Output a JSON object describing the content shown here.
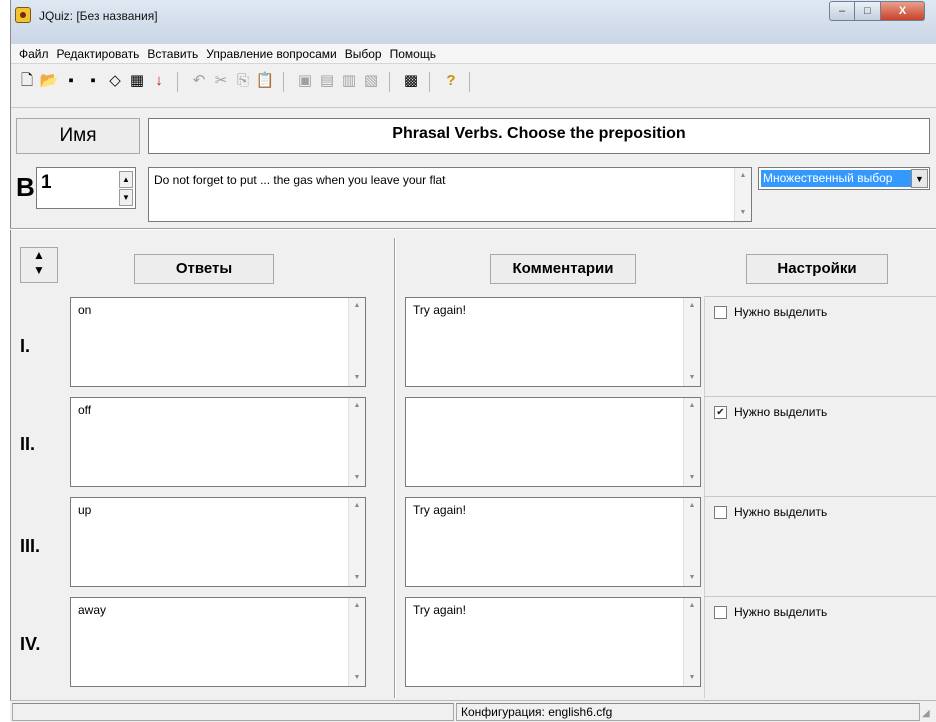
{
  "window": {
    "title": "JQuiz: [Без названия]",
    "minimize": "–",
    "maximize": "□",
    "close": "X"
  },
  "menu": [
    "Файл",
    "Редактировать",
    "Вставить",
    "Управление вопросами",
    "Выбор",
    "Помощь"
  ],
  "toolbar": {
    "new_icon": "new-file-icon",
    "open_icon": "open-folder-icon",
    "save_icon": "save-icon",
    "save_as_icon": "save-as-icon",
    "eraser_icon": "eraser-icon",
    "export_icon": "export-icon",
    "arrow_icon": "down-arrow-icon",
    "undo_icon": "undo-icon",
    "cut_icon": "cut-icon",
    "copy_icon": "copy-icon",
    "paste_icon": "paste-icon",
    "help_icon": "help-icon"
  },
  "header": {
    "name_label": "Имя",
    "quiz_title": "Phrasal Verbs. Choose the preposition",
    "question_label": "В",
    "question_number": "1",
    "question_text": "Do not forget to put ... the gas when you leave your flat",
    "question_type": "Множественный выбор"
  },
  "columns": {
    "answers": "Ответы",
    "comments": "Комментарии",
    "settings": "Настройки"
  },
  "rows": [
    {
      "roman": "I.",
      "answer": "on",
      "comment": "Try again!",
      "setting_label": "Нужно выделить",
      "checked": false
    },
    {
      "roman": "II.",
      "answer": "off",
      "comment": "",
      "setting_label": "Нужно выделить",
      "checked": true
    },
    {
      "roman": "III.",
      "answer": "up",
      "comment": "Try again!",
      "setting_label": "Нужно выделить",
      "checked": false
    },
    {
      "roman": "IV.",
      "answer": "away",
      "comment": "Try again!",
      "setting_label": "Нужно выделить",
      "checked": false
    }
  ],
  "status": {
    "config": "Конфигурация: english6.cfg"
  },
  "colors": {
    "selection": "#3399ff",
    "window_bg": "#f0f0f0",
    "close_button": "#c9422a"
  }
}
